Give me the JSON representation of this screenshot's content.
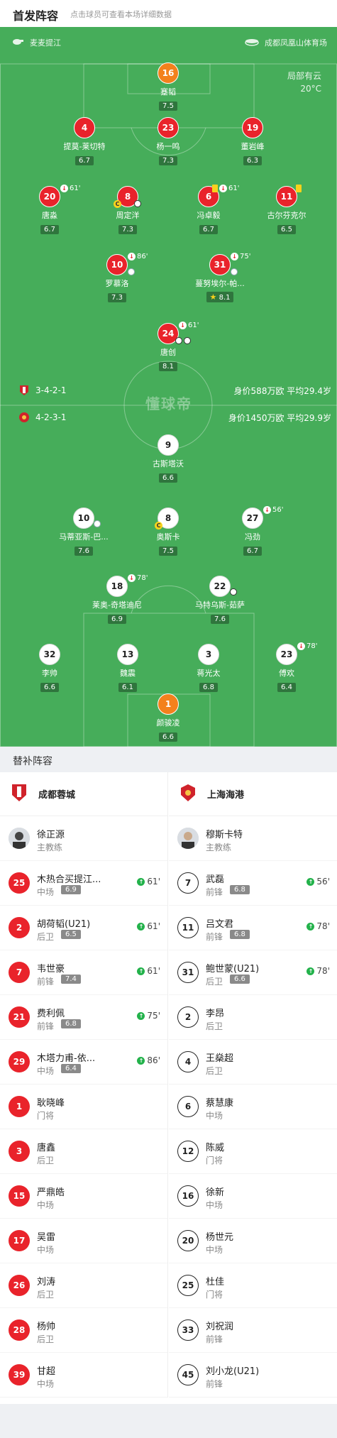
{
  "header": {
    "title": "首发阵容",
    "subtitle": "点击球员可查看本场详细数据"
  },
  "pitch": {
    "home_team_name": "麦麦提江",
    "venue": "成都凤凰山体育场",
    "weather_text": "局部有云",
    "temperature": "20°C",
    "watermark": "懂球帝",
    "home_formation": "3-4-2-1",
    "home_info": "身价588万欧   平均29.4岁",
    "away_formation": "4-2-3-1",
    "away_info": "身价1450万欧   平均29.9岁"
  },
  "home_players": [
    {
      "num": "16",
      "name": "蹇韬",
      "rating": "7.5",
      "color": "orange"
    },
    {
      "num": "4",
      "name": "提莫-莱切特",
      "rating": "6.7",
      "color": "red"
    },
    {
      "num": "23",
      "name": "杨一鸣",
      "rating": "7.3",
      "color": "red"
    },
    {
      "num": "19",
      "name": "董岩峰",
      "rating": "6.3",
      "color": "red"
    },
    {
      "num": "20",
      "name": "唐淼",
      "rating": "6.7",
      "color": "red",
      "sub": "61'"
    },
    {
      "num": "8",
      "name": "周定洋",
      "rating": "7.3",
      "color": "red"
    },
    {
      "num": "6",
      "name": "冯卓毅",
      "rating": "6.7",
      "color": "red",
      "sub": "61'"
    },
    {
      "num": "11",
      "name": "古尔芬克尔",
      "rating": "6.5",
      "color": "red"
    },
    {
      "num": "10",
      "name": "罗慕洛",
      "rating": "7.3",
      "color": "red",
      "sub": "86'"
    },
    {
      "num": "31",
      "name": "蔓努埃尔-帕...",
      "rating": "8.1",
      "color": "red",
      "sub": "75'"
    },
    {
      "num": "24",
      "name": "唐创",
      "rating": "8.1",
      "color": "red",
      "sub": "61'"
    }
  ],
  "away_players": [
    {
      "num": "9",
      "name": "古斯塔沃",
      "rating": "6.6",
      "color": "white"
    },
    {
      "num": "10",
      "name": "马蒂亚斯-巴...",
      "rating": "7.6",
      "color": "white"
    },
    {
      "num": "8",
      "name": "奥斯卡",
      "rating": "7.5",
      "color": "white"
    },
    {
      "num": "27",
      "name": "冯劲",
      "rating": "6.7",
      "color": "white",
      "sub": "56'"
    },
    {
      "num": "18",
      "name": "莱奥-奇塔迪尼",
      "rating": "6.9",
      "color": "white",
      "sub": "78'"
    },
    {
      "num": "22",
      "name": "马特乌斯-茹萨",
      "rating": "7.6",
      "color": "white"
    },
    {
      "num": "32",
      "name": "李帅",
      "rating": "6.6",
      "color": "white"
    },
    {
      "num": "13",
      "name": "魏震",
      "rating": "6.1",
      "color": "white"
    },
    {
      "num": "3",
      "name": "蒋光太",
      "rating": "6.8",
      "color": "white"
    },
    {
      "num": "23",
      "name": "傅欢",
      "rating": "6.4",
      "color": "white",
      "sub": "78'"
    },
    {
      "num": "1",
      "name": "颜骏凌",
      "rating": "6.6",
      "color": "orange"
    }
  ],
  "subs": {
    "title": "替补阵容",
    "home_team": "成都蓉城",
    "away_team": "上海海港",
    "home_coach": {
      "name": "徐正源",
      "role": "主教练"
    },
    "away_coach": {
      "name": "穆斯卡特",
      "role": "主教练"
    },
    "home": [
      {
        "num": "25",
        "name": "木热合买提江...",
        "pos": "中场",
        "rating": "6.9",
        "in": "61'"
      },
      {
        "num": "2",
        "name": "胡荷韬(U21)",
        "pos": "后卫",
        "rating": "6.5",
        "in": "61'"
      },
      {
        "num": "7",
        "name": "韦世豪",
        "pos": "前锋",
        "rating": "7.4",
        "in": "61'"
      },
      {
        "num": "21",
        "name": "费利佩",
        "pos": "前锋",
        "rating": "6.8",
        "in": "75'"
      },
      {
        "num": "29",
        "name": "木塔力甫-依...",
        "pos": "中场",
        "rating": "6.4",
        "in": "86'"
      },
      {
        "num": "1",
        "name": "耿晓峰",
        "pos": "门将"
      },
      {
        "num": "3",
        "name": "唐鑫",
        "pos": "后卫"
      },
      {
        "num": "15",
        "name": "严鼎皓",
        "pos": "中场"
      },
      {
        "num": "17",
        "name": "吴雷",
        "pos": "中场"
      },
      {
        "num": "26",
        "name": "刘涛",
        "pos": "后卫"
      },
      {
        "num": "28",
        "name": "杨帅",
        "pos": "后卫"
      },
      {
        "num": "39",
        "name": "甘超",
        "pos": "中场"
      }
    ],
    "away": [
      {
        "num": "7",
        "name": "武磊",
        "pos": "前锋",
        "rating": "6.8",
        "in": "56'"
      },
      {
        "num": "11",
        "name": "吕文君",
        "pos": "前锋",
        "rating": "6.8",
        "in": "78'"
      },
      {
        "num": "31",
        "name": "鲍世蒙(U21)",
        "pos": "后卫",
        "rating": "6.6",
        "in": "78'"
      },
      {
        "num": "2",
        "name": "李昂",
        "pos": "后卫"
      },
      {
        "num": "4",
        "name": "王燊超",
        "pos": "后卫"
      },
      {
        "num": "6",
        "name": "蔡慧康",
        "pos": "中场"
      },
      {
        "num": "12",
        "name": "陈威",
        "pos": "门将"
      },
      {
        "num": "16",
        "name": "徐新",
        "pos": "中场"
      },
      {
        "num": "20",
        "name": "杨世元",
        "pos": "中场"
      },
      {
        "num": "25",
        "name": "杜佳",
        "pos": "门将"
      },
      {
        "num": "33",
        "name": "刘祝润",
        "pos": "前锋"
      },
      {
        "num": "45",
        "name": "刘小龙(U21)",
        "pos": "前锋"
      }
    ]
  }
}
